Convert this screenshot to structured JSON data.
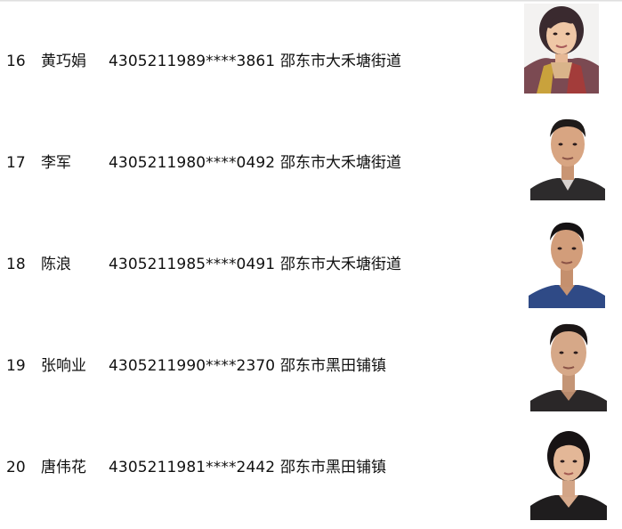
{
  "records": [
    {
      "num": "16",
      "name": "黄巧娟",
      "id_number": "4305211989****3861",
      "address": "邵东市大禾塘街道"
    },
    {
      "num": "17",
      "name": "李军",
      "id_number": "4305211980****0492",
      "address": "邵东市大禾塘街道"
    },
    {
      "num": "18",
      "name": "陈浪",
      "id_number": "4305211985****0491",
      "address": "邵东市大禾塘街道"
    },
    {
      "num": "19",
      "name": "张响业",
      "id_number": "4305211990****2370",
      "address": "邵东市黑田铺镇"
    },
    {
      "num": "20",
      "name": "唐伟花",
      "id_number": "4305211981****2442",
      "address": "邵东市黑田铺镇"
    }
  ]
}
